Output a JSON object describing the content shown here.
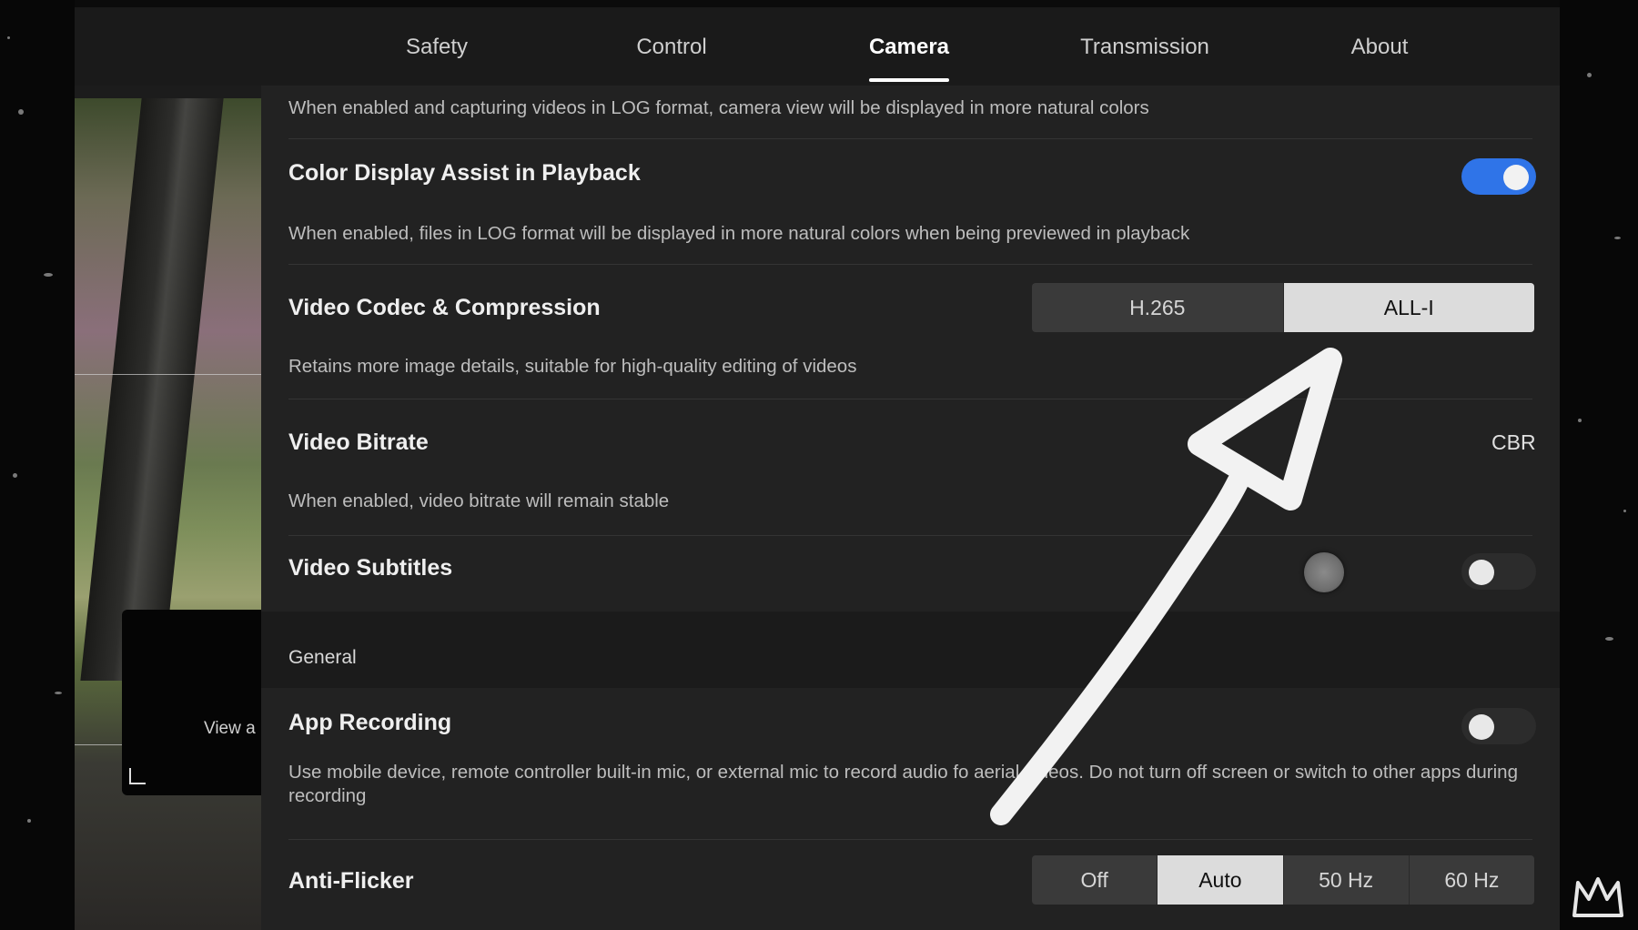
{
  "tabs": [
    {
      "label": "Safety",
      "active": false
    },
    {
      "label": "Control",
      "active": false
    },
    {
      "label": "Camera",
      "active": true
    },
    {
      "label": "Transmission",
      "active": false
    },
    {
      "label": "About",
      "active": false
    }
  ],
  "preview": {
    "view_text": "View a"
  },
  "settings": {
    "top_desc": "When enabled and capturing videos in LOG format, camera view will be displayed in more natural colors",
    "color_display": {
      "title": "Color Display Assist in Playback",
      "desc": "When enabled, files in LOG format will be displayed in more natural colors when being previewed in playback",
      "enabled": true
    },
    "codec": {
      "title": "Video Codec & Compression",
      "options": [
        "H.265",
        "ALL-I"
      ],
      "selected": "ALL-I",
      "desc": "Retains more image details, suitable for high-quality editing of videos"
    },
    "bitrate": {
      "title": "Video Bitrate",
      "value": "CBR",
      "desc": "When enabled, video bitrate will remain stable"
    },
    "subtitles": {
      "title": "Video Subtitles",
      "enabled": false
    },
    "general_label": "General",
    "app_recording": {
      "title": "App Recording",
      "enabled": false,
      "desc": "Use mobile device, remote controller built-in mic, or external mic to record audio fo aerial videos. Do not turn off screen or switch to other apps during recording"
    },
    "anti_flicker": {
      "title": "Anti-Flicker",
      "options": [
        "Off",
        "Auto",
        "50 Hz",
        "60 Hz"
      ],
      "selected": "Auto"
    }
  },
  "colors": {
    "toggle_on": "#2f74e8",
    "selected_segment": "#dcdcdc",
    "annotation_arrow": "#f2f2f2"
  },
  "icons": [
    "corner-bracket-icon",
    "hand-drawn-arrow",
    "crown-logo-icon"
  ]
}
